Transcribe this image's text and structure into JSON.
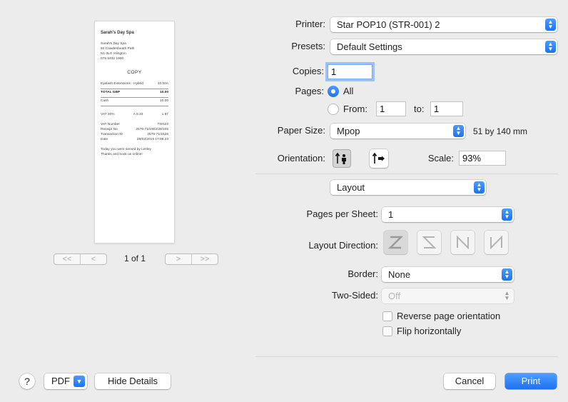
{
  "preview": {
    "shop_name": "Sarah's Day Spa",
    "address": [
      "Sarah's Day Spa",
      "92 Cowdenbeath Path",
      "N1 0LG Islington",
      "076 5432 1000"
    ],
    "copy_label": "COPY",
    "item": {
      "name": "Eyelash Extensions - Hybrid",
      "price": "10.00A"
    },
    "total": {
      "label": "TOTAL GBP",
      "value": "10.00"
    },
    "cash": {
      "label": "Cash",
      "value": "10.00"
    },
    "vat": {
      "label": "VAT 20%",
      "base": "A 8.33",
      "value": "1.67"
    },
    "meta": [
      {
        "label": "VAT Number",
        "value": "TW123"
      },
      {
        "label": "Receipt No",
        "value": "2576-71/1902/28/105"
      },
      {
        "label": "Transaction ID",
        "value": "2576-71/1526"
      },
      {
        "label": "Date",
        "value": "28/02/2019 17:06:23"
      }
    ],
    "footer": [
      "Today you were served by Lesley",
      "Thanks and book us online!"
    ],
    "page_count": "1 of 1",
    "pager_first": "<<",
    "pager_prev": "<",
    "pager_next": ">",
    "pager_last": ">>"
  },
  "printer": {
    "label": "Printer:",
    "value": "Star POP10 (STR-001) 2"
  },
  "presets": {
    "label": "Presets:",
    "value": "Default Settings"
  },
  "copies": {
    "label": "Copies:",
    "value": "1"
  },
  "pages": {
    "label": "Pages:",
    "all_label": "All",
    "from_label": "From:",
    "from_value": "1",
    "to_label": "to:",
    "to_value": "1"
  },
  "paper_size": {
    "label": "Paper Size:",
    "value": "Mpop",
    "dimensions": "51 by 140 mm"
  },
  "orientation": {
    "label": "Orientation:"
  },
  "scale": {
    "label": "Scale:",
    "value": "93%"
  },
  "section": {
    "value": "Layout"
  },
  "pages_per_sheet": {
    "label": "Pages per Sheet:",
    "value": "1"
  },
  "layout_direction": {
    "label": "Layout Direction:"
  },
  "border": {
    "label": "Border:",
    "value": "None"
  },
  "two_sided": {
    "label": "Two-Sided:",
    "value": "Off"
  },
  "reverse_orientation": {
    "label": "Reverse page orientation"
  },
  "flip_horizontally": {
    "label": "Flip horizontally"
  },
  "bottom": {
    "help": "?",
    "pdf": "PDF",
    "hide_details": "Hide Details",
    "cancel": "Cancel",
    "print": "Print"
  },
  "colors": {
    "accent": "#1d73f0",
    "background": "#ececec"
  }
}
